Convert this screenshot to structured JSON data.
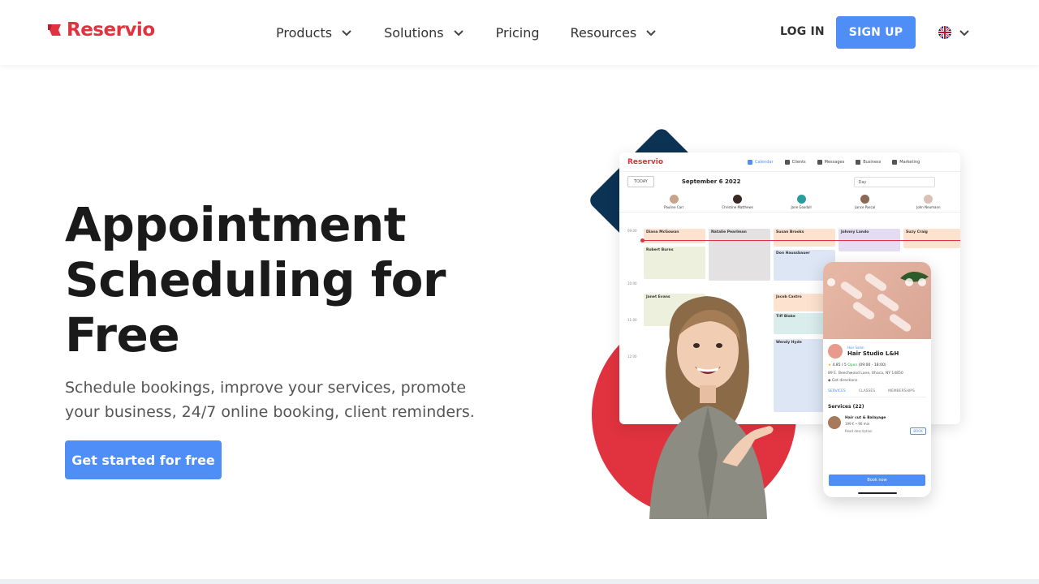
{
  "header": {
    "logo_text": "Reservio",
    "nav": [
      {
        "label": "Products",
        "has_dropdown": true
      },
      {
        "label": "Solutions",
        "has_dropdown": true
      },
      {
        "label": "Pricing",
        "has_dropdown": false
      },
      {
        "label": "Resources",
        "has_dropdown": true
      }
    ],
    "login_label": "LOG IN",
    "signup_label": "SIGN UP",
    "language_icon": "uk-flag-icon"
  },
  "hero": {
    "title": "Appointment Scheduling for Free",
    "subtitle": "Schedule bookings, improve your services, promote your business, 24/7 online booking, client reminders.",
    "cta_label": "Get started for free"
  },
  "illustration": {
    "calendar": {
      "logo": "Reservio",
      "tabs": [
        "Calendar",
        "Clients",
        "Messages",
        "Business",
        "Marketing"
      ],
      "today_label": "TODAY",
      "date": "September 6 2022",
      "view": "Day",
      "staff": [
        "Pauline Carr",
        "Christine Matthews",
        "Jane Goodall",
        "Lance Pascal",
        "John Neumann"
      ],
      "times": [
        "09:00",
        "10:00",
        "11:00",
        "12:00"
      ],
      "appointments": [
        {
          "name": "Diana McGowan",
          "color": "#fde3cf"
        },
        {
          "name": "Robert Burns",
          "color": "#eef0de"
        },
        {
          "name": "Janet Evans",
          "color": "#eef0de"
        },
        {
          "name": "Natalie Pearlman",
          "color": "#e3e1e1"
        },
        {
          "name": "Susan Brooks",
          "color": "#fde3cf"
        },
        {
          "name": "Don Haussbauer",
          "color": "#dde6f5"
        },
        {
          "name": "Jacob Castro",
          "color": "#fde3cf"
        },
        {
          "name": "Tiff Blake",
          "color": "#d9eded"
        },
        {
          "name": "Wendy Hyde",
          "color": "#dde6f5"
        },
        {
          "name": "Johnny Lando",
          "color": "#e3dcf2"
        },
        {
          "name": "Suzy Craig",
          "color": "#fde3cf"
        }
      ]
    },
    "phone": {
      "category": "Hair Salon",
      "name": "Hair Studio L&H",
      "rating": "4.85 / 5",
      "status": "Open",
      "hours": "(09:00 - 18:00)",
      "address": "89 E. Beechwood Lane, Ithaca, NY 14850",
      "directions": "Get directions",
      "tabs": [
        "SERVICES",
        "CLASSES",
        "MEMBERSHIPS"
      ],
      "services_title": "Services (22)",
      "service_name": "Hair cut & Balayage",
      "service_price": "199 € • 90 min",
      "service_more": "Read description",
      "book_label": "BOOK",
      "cta_label": "Book now"
    }
  }
}
